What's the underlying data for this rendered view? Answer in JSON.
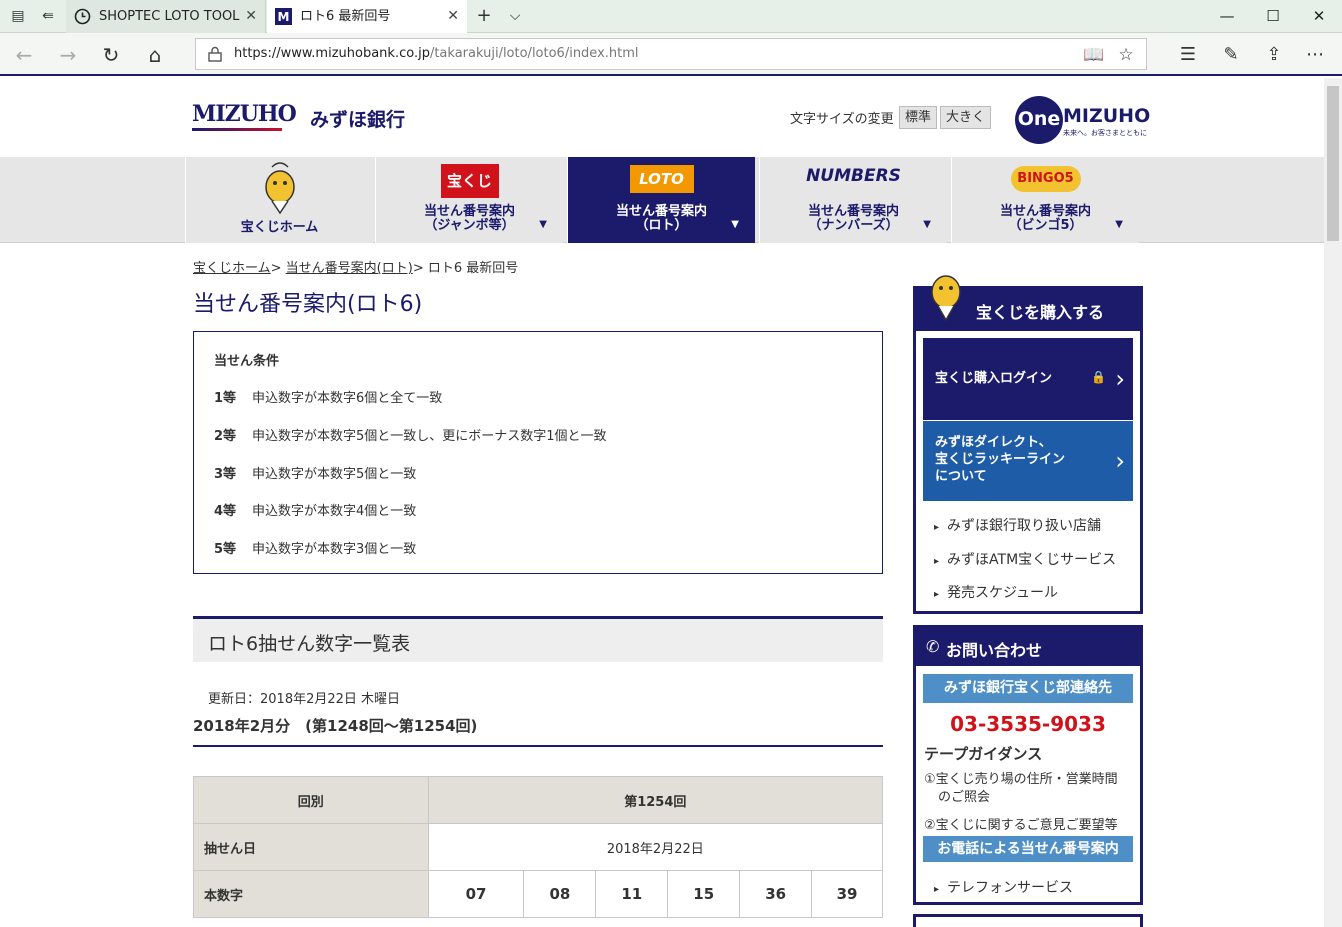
{
  "browser": {
    "tabs": [
      {
        "title": "SHOPTEC LOTO TOOL",
        "icon": "clock-icon"
      },
      {
        "title": "ロト6 最新回号",
        "icon": "mizuho-m-icon"
      }
    ],
    "new_tab": "+",
    "tab_list": "⌵",
    "url_host": "https://www.mizuhobank.co.jp",
    "url_path": "/takarakuji/loto/loto6/index.html"
  },
  "header": {
    "logo_text": "MIZUHO",
    "bank_name": "みずほ銀行",
    "font_size_label": "文字サイズの変更",
    "font_size_normal": "標準",
    "font_size_large": "大きく",
    "one_logo_one": "One",
    "one_logo_mizuho": "MIZUHO",
    "one_logo_tagline": "未来へ。お客さまとともに"
  },
  "nav": [
    {
      "label_1": "宝くじホーム",
      "label_2": "",
      "logo": ""
    },
    {
      "label_1": "当せん番号案内",
      "label_2": "（ジャンボ等）",
      "logo": "宝くじ"
    },
    {
      "label_1": "当せん番号案内",
      "label_2": "（ロト）",
      "logo": "LOTO"
    },
    {
      "label_1": "当せん番号案内",
      "label_2": "（ナンバーズ）",
      "logo": "NUMBERS"
    },
    {
      "label_1": "当せん番号案内",
      "label_2": "（ビンゴ5）",
      "logo": "BINGO5"
    }
  ],
  "breadcrumb": {
    "home": "宝くじホーム",
    "sep": ">",
    "loto": "当せん番号案内(ロト)",
    "current": "ロト6 最新回号"
  },
  "page_title": "当せん番号案内(ロト6)",
  "conditions": {
    "heading": "当せん条件",
    "rows": [
      {
        "rank": "1等",
        "text": "申込数字が本数字6個と全て一致"
      },
      {
        "rank": "2等",
        "text": "申込数字が本数字5個と一致し、更にボーナス数字1個と一致"
      },
      {
        "rank": "3等",
        "text": "申込数字が本数字5個と一致"
      },
      {
        "rank": "4等",
        "text": "申込数字が本数字4個と一致"
      },
      {
        "rank": "5等",
        "text": "申込数字が本数字3個と一致"
      }
    ]
  },
  "results": {
    "section_title": "ロト6抽せん数字一覧表",
    "updated": "更新日：2018年2月22日 木曜日",
    "month_heading": "2018年2月分　(第1248回～第1254回)",
    "table": {
      "round_label": "回別",
      "round_value": "第1254回",
      "date_label": "抽せん日",
      "date_value": "2018年2月22日",
      "numbers_label": "本数字",
      "numbers": [
        "07",
        "08",
        "11",
        "15",
        "36",
        "39"
      ]
    }
  },
  "sidebar": {
    "buy_title": "宝くじを購入する",
    "login_button": "宝くじ購入ログイン",
    "direct_line_1": "みずほダイレクト、",
    "direct_line_2": "宝くじラッキーライン",
    "direct_line_3": "について",
    "links": [
      "みずほ銀行取り扱い店舗",
      "みずほATM宝くじサービス",
      "発売スケジュール"
    ],
    "contact_title": "お問い合わせ",
    "contact_dept": "みずほ銀行宝くじ部連絡先",
    "phone": "03-3535-9033",
    "tape_heading": "テープガイダンス",
    "tape_1a": "①宝くじ売り場の住所・営業時間",
    "tape_1b": "のご照会",
    "tape_2": "②宝くじに関するご意見ご要望等",
    "phone_result": "お電話による当せん番号案内",
    "tel_service": "テレフォンサービス"
  },
  "colors": {
    "brand_navy": "#1b1a6b",
    "accent_blue": "#4f8fc7",
    "phone_red": "#d2121a"
  }
}
